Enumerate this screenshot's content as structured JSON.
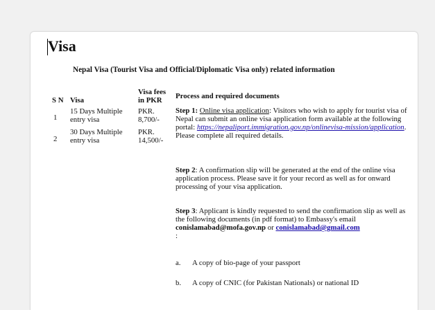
{
  "page_title": "Visa",
  "subtitle": "Nepal Visa (Tourist Visa and Official/Diplomatic Visa only) related information",
  "table": {
    "headers": {
      "sn": "S N",
      "visa": "Visa",
      "fees_line1": "Visa fees",
      "fees_line2": "in PKR",
      "process": "Process and required documents"
    },
    "rows": [
      {
        "sn": "1",
        "visa_line1": "15 Days Multiple",
        "visa_line2": "entry visa",
        "fee_line1": "PKR.",
        "fee_line2": "8,700/-"
      },
      {
        "sn": "2",
        "visa_line1": "30 Days Multiple",
        "visa_line2": "entry visa",
        "fee_line1": "PKR.",
        "fee_line2": "14,500/-"
      }
    ]
  },
  "steps": {
    "step1_label": "Step 1",
    "step1_link_label": "Online visa application",
    "step1_text": ": Visitors who wish to apply for tourist visa of Nepal can submit an online visa application form available at the following portal:",
    "step1_url": "https://nepaliport.immigration.gov.np/onlinevisa-mission/application",
    "step1_after": ". Please complete all required details.",
    "step2_label": "Step 2",
    "step2_text": ":  A confirmation slip will be generated at the end of the online visa application process. Please save it for your record as well as for onward processing of your visa application.",
    "step3_label": "Step 3",
    "step3_text": ":  Applicant is kindly requested to send the confirmation slip as well as the following documents (in pdf format) to Embassy's email ",
    "step3_email1": "conislamabad@mofa.gov.np",
    "step3_or": " or ",
    "step3_email2": "conislamabad@gmail.com",
    "step3_end": ":"
  },
  "documents": [
    {
      "marker": "a.",
      "text": "A copy of bio-page of your passport"
    },
    {
      "marker": "b.",
      "text": "A copy of CNIC (for Pakistan Nationals) or national ID"
    }
  ]
}
